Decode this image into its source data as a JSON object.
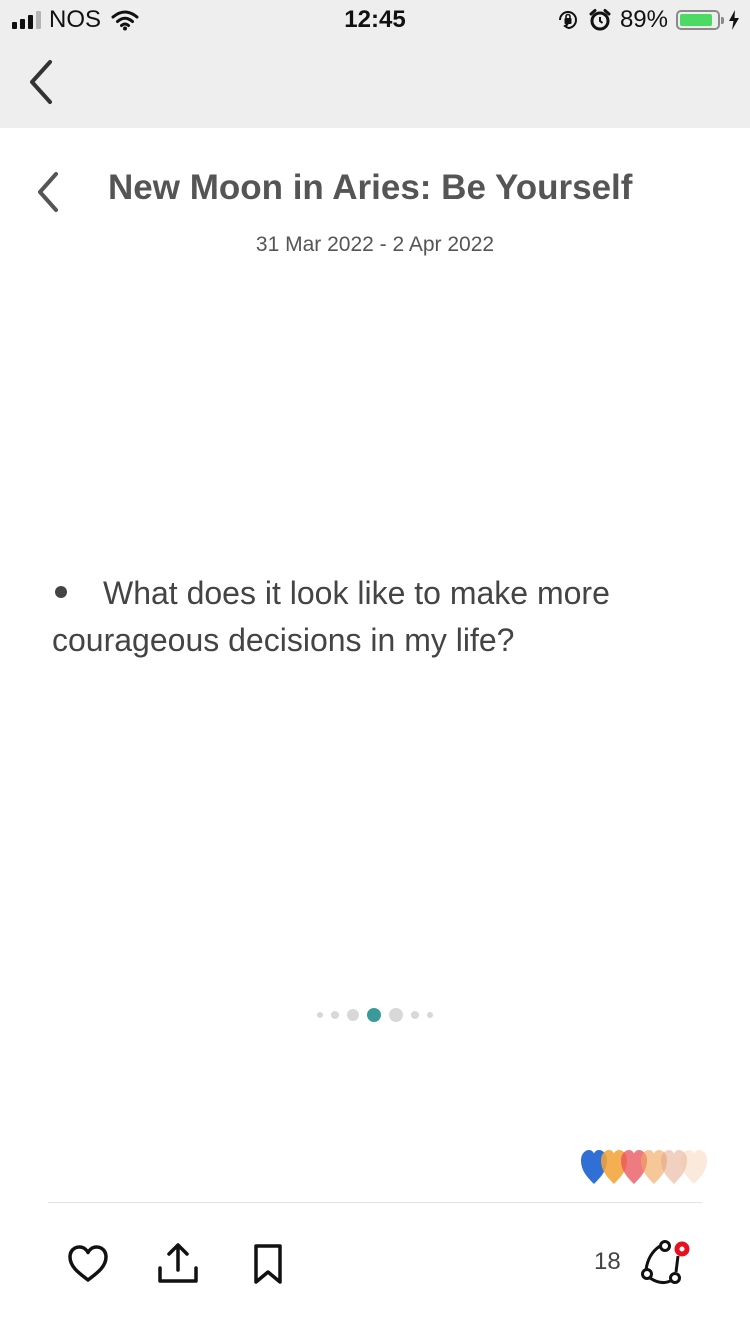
{
  "status_bar": {
    "carrier": "NOS",
    "time": "12:45",
    "battery_percent": "89%",
    "battery_level": 0.89,
    "battery_color": "#4cd964",
    "icons": [
      "signal-icon",
      "wifi-icon",
      "orientation-lock-icon",
      "alarm-icon",
      "battery-icon",
      "charging-bolt-icon"
    ]
  },
  "nav": {
    "back_icon": "chevron-left-icon"
  },
  "header": {
    "title": "New Moon in Aries: Be Yourself",
    "date_range": "31 Mar 2022 - 2 Apr 2022"
  },
  "content": {
    "bullet": "What does it look like to make more courageous decisions in my life?"
  },
  "pager": {
    "total": 7,
    "active_index": 4,
    "active_color": "#3a9a9a",
    "inactive_color": "#d8d8d8"
  },
  "reactions": {
    "heart_colors": [
      "#2f6fd6",
      "#f2a43a",
      "#e8505b",
      "#f0a860",
      "#e4a48a",
      "#f6c9a6"
    ]
  },
  "toolbar": {
    "like_icon": "heart-outline-icon",
    "share_icon": "share-icon",
    "bookmark_icon": "bookmark-icon",
    "comment_count": "18",
    "connect_icon": "connect-nodes-icon",
    "badge_color": "#e8101e"
  }
}
